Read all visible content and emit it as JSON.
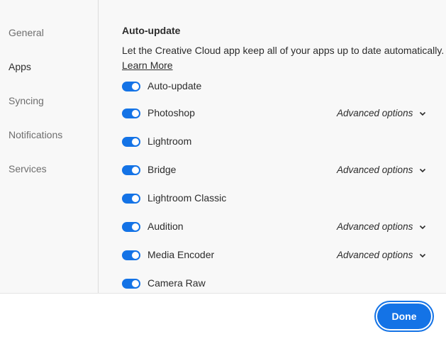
{
  "sidebar": {
    "items": [
      {
        "label": "General"
      },
      {
        "label": "Apps"
      },
      {
        "label": "Syncing"
      },
      {
        "label": "Notifications"
      },
      {
        "label": "Services"
      }
    ],
    "active": "Apps"
  },
  "main": {
    "section_title": "Auto-update",
    "description": "Let the Creative Cloud app keep all of your apps up to date automatically.",
    "learn_more": "Learn More",
    "master_toggle": {
      "label": "Auto-update",
      "on": true
    },
    "apps": [
      {
        "name": "Photoshop",
        "on": true,
        "advanced": "Advanced options"
      },
      {
        "name": "Lightroom",
        "on": true
      },
      {
        "name": "Bridge",
        "on": true,
        "advanced": "Advanced options"
      },
      {
        "name": "Lightroom Classic",
        "on": true
      },
      {
        "name": "Audition",
        "on": true,
        "advanced": "Advanced options"
      },
      {
        "name": "Media Encoder",
        "on": true,
        "advanced": "Advanced options"
      },
      {
        "name": "Camera Raw",
        "on": true
      }
    ]
  },
  "footer": {
    "done_label": "Done"
  },
  "colors": {
    "accent": "#1473e6",
    "panel_bg": "#f8f8f8"
  },
  "icons": {
    "toggle": "toggle-switch-on",
    "chevron": "chevron-down-icon"
  }
}
